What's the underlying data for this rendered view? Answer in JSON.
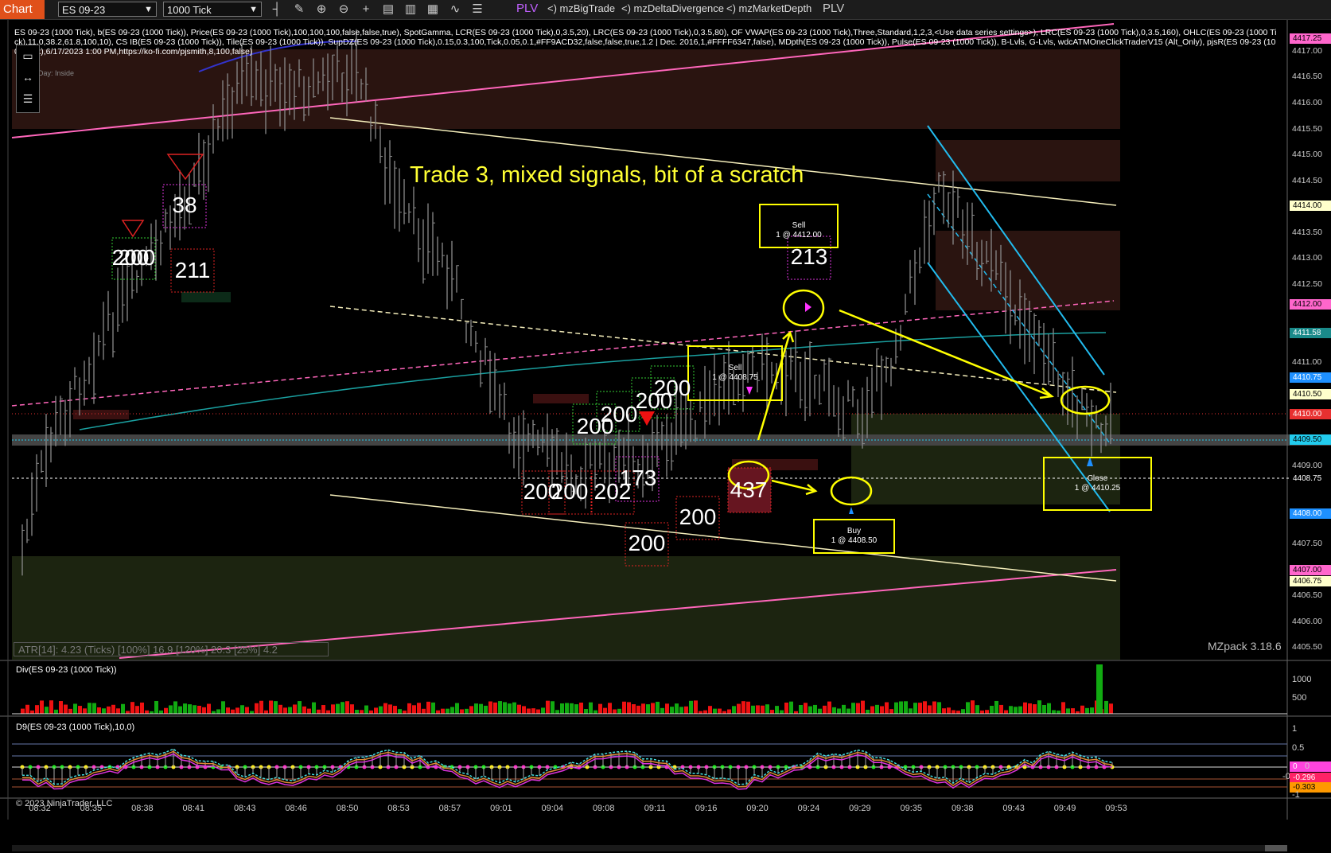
{
  "toolbar": {
    "title": "Chart",
    "instrument": "ES 09-23",
    "interval": "1000 Tick",
    "plv_label": "PLV",
    "indicators": [
      "<) mzBigTrade",
      "<) mzDeltaDivergence",
      "<) mzMarketDepth"
    ],
    "plv2_label": "PLV"
  },
  "indicator_text": "ES 09-23 (1000 Tick), b(ES 09-23 (1000 Tick)), Price(ES 09-23 (1000 Tick),100,100,100,false,false,true), SpotGamma, LCR(ES 09-23 (1000 Tick),0,3.5,20), LRC(ES 09-23 (1000 Tick),0,3.5,80), OF VWAP(ES 09-23 (1000 Tick),Three,Standard,1,2,3,<Use data series settings>), LRC(ES 09-23 (1000 Tick),0,3.5,160), OHLC(ES 09-23 (1000 Tick),11,0,38.2,61.8,100,10), CS IB(ES 09-23 (1000 Tick)), Tile(ES 09-23 (1000 Tick)), SupDZ(ES 09-23 (1000 Tick),0.15,0.3,100,Tick,0.05,0.1,#FF9ACD32,false,false,true,1.2 | Dec. 2016,1,#FFFF6347,false), MDpth(ES 09-23 (1000 Tick)), Pulse(ES 09-23 (1000 Tick)), B-Lvls, G-Lvls, wdcATMOneClickTraderV15 (Alt_Only), pjsR(ES 09-23 (1000 Tick),6/17/2023 1:00 PM,https://ko-fi.com/pjsmith,8,100,false)",
  "day_inside": "Day: Inside",
  "headline": "Trade 3, mixed signals, bit of a scratch",
  "trades": [
    {
      "label": "Sell",
      "detail": "1 @ 4412.00"
    },
    {
      "label": "Sell",
      "detail": "1 @ 4408.75"
    },
    {
      "label": "Buy",
      "detail": "1 @ 4408.50"
    },
    {
      "label": "Close",
      "detail": "1 @ 4410.25"
    }
  ],
  "volume_labels": [
    "200",
    "200",
    "38",
    "211",
    "200",
    "200",
    "200",
    "200",
    "200",
    "200",
    "202",
    "173",
    "200",
    "200",
    "437",
    "213"
  ],
  "price_axis": [
    "4417.00",
    "4416.50",
    "4416.00",
    "4415.50",
    "4415.00",
    "4414.50",
    "4413.50",
    "4413.00",
    "4412.50",
    "4411.00",
    "4409.00",
    "4407.50",
    "4406.50",
    "4406.00",
    "4405.50"
  ],
  "price_tags": [
    {
      "text": "4417.25",
      "color": "#ff66cc"
    },
    {
      "text": "4414.00",
      "color": "#ffffcc"
    },
    {
      "text": "4412.00",
      "color": "#ff66cc"
    },
    {
      "text": "4411.58",
      "color": "#1a8a8a"
    },
    {
      "text": "4410.75",
      "color": "#1e90ff"
    },
    {
      "text": "4410.50",
      "color": "#ffffcc"
    },
    {
      "text": "4410.00",
      "color": "#e83030"
    },
    {
      "text": "4409.50",
      "color": "#22ccee"
    },
    {
      "text": "4408.75",
      "color": "#000000"
    },
    {
      "text": "4408.00",
      "color": "#1e90ff"
    },
    {
      "text": "4407.00",
      "color": "#ff66cc"
    },
    {
      "text": "4406.75",
      "color": "#ffffcc"
    }
  ],
  "time_axis": [
    "08:32",
    "08:35",
    "08:38",
    "08:41",
    "08:43",
    "08:46",
    "08:50",
    "08:53",
    "08:57",
    "09:01",
    "09:04",
    "09:08",
    "09:11",
    "09:16",
    "09:20",
    "09:24",
    "09:29",
    "09:35",
    "09:38",
    "09:43",
    "09:49",
    "09:53"
  ],
  "atr": "ATR[14]: 4.23 (Ticks) [100%] 16.9  [120%] 20.3  [25%] 4.2",
  "mzpack": "MZpack 3.18.6",
  "div_title": "Div(ES 09-23 (1000 Tick))",
  "div_axis": [
    "1000",
    "500"
  ],
  "d9_title": "D9(ES 09-23 (1000 Tick),10,0)",
  "d9_axis": [
    "1",
    "0.5",
    "0",
    "-0.5",
    "-1"
  ],
  "d9_tags": [
    {
      "text": "0",
      "color": "#ff44dd"
    },
    {
      "text": "-0.296",
      "color": "#ff2266"
    },
    {
      "text": "-0.303",
      "color": "#ff9900"
    }
  ],
  "copyright": "© 2023 NinjaTrader, LLC"
}
